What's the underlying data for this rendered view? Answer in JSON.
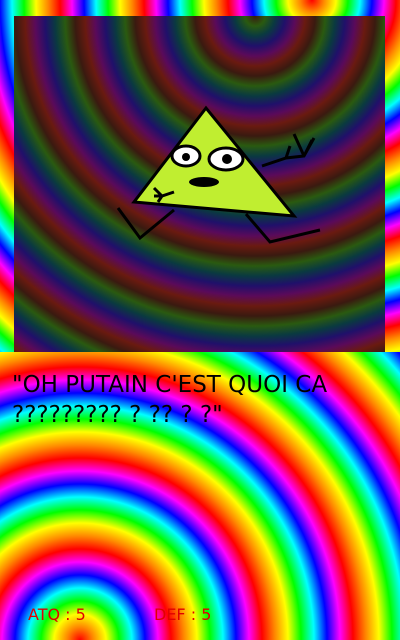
{
  "card": {
    "quote": "\"OH PUTAIN C'EST QUOI CA ????????? ? ?? ? ?\"",
    "stats": {
      "attack_label": "ATQ : 5",
      "defense_label": "DEF : 5"
    }
  },
  "colors": {
    "stat_text": "#e00000",
    "triangle_fill": "#c0ee30"
  },
  "icons": {
    "character": "triangle-monster-icon"
  }
}
